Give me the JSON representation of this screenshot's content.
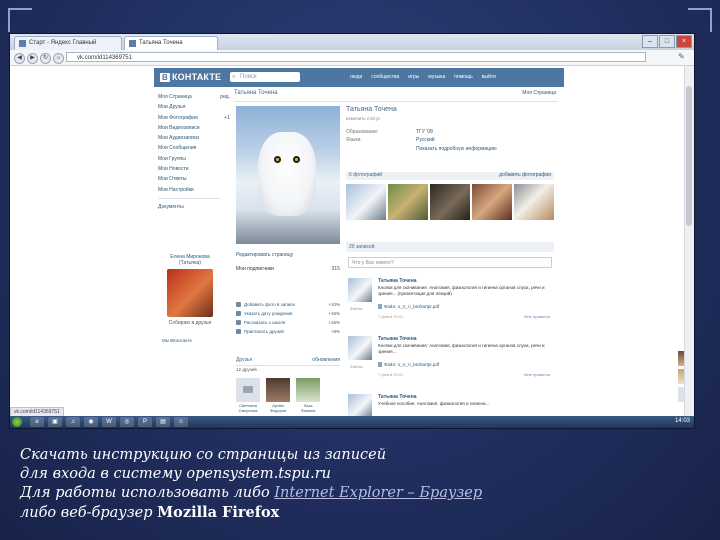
{
  "browser": {
    "tabs": [
      {
        "label": "Старт - Яндекс Главный"
      },
      {
        "label": "Татьяна Точена"
      }
    ],
    "url": "vk.com/id114369751",
    "window_buttons": [
      "–",
      "□",
      "×"
    ],
    "status_url": "vk.com/id114369751"
  },
  "vk": {
    "logo_mark": "B",
    "logo_text": "КОНТАКТЕ",
    "search_placeholder": "Поиск",
    "top_menu": [
      "люди",
      "сообщества",
      "игры",
      "музыка",
      "помощь",
      "выйти"
    ],
    "left_menu": [
      {
        "label": "Моя Страница",
        "count": "ред."
      },
      {
        "label": "Мои Друзья",
        "count": ""
      },
      {
        "label": "Мои Фотографии",
        "count": "+1"
      },
      {
        "label": "Мои Видеозаписи",
        "count": ""
      },
      {
        "label": "Мои Аудиозаписи",
        "count": ""
      },
      {
        "label": "Мои Сообщения",
        "count": ""
      },
      {
        "label": "Мои Группы",
        "count": ""
      },
      {
        "label": "Мои Новости",
        "count": ""
      },
      {
        "label": "Мои Ответы",
        "count": ""
      },
      {
        "label": "Мои Настройки",
        "count": ""
      }
    ],
    "left_extra": "Документы",
    "friend_card": {
      "name": "Елена Миронова (Татьяна)",
      "status": "Собираю в друзья"
    },
    "left_small": "Мы ВКонтакте"
  },
  "profile": {
    "header_name": "Татьяна Точена",
    "header_right": "Моя Страница",
    "name": "Татьяна Точена",
    "status": "изменить статус",
    "info": [
      {
        "key": "Образование:",
        "value": "ТГУ '08"
      },
      {
        "key": "Языки:",
        "value": "Русский"
      }
    ],
    "more_info": "Показать подробную информацию",
    "edit_link": "Редактировать страницу",
    "followers_label": "Мои подписчики",
    "followers_count": "315",
    "subscriptions": [
      {
        "label": "Добавить фото в записи",
        "pct": "+10%"
      },
      {
        "label": "Указать дату рождения",
        "pct": "+15%"
      },
      {
        "label": "Рассказать о школе",
        "pct": "+15%"
      },
      {
        "label": "Пригласить друзей",
        "pct": "+8%"
      }
    ],
    "friends_title": "Друзья",
    "friends_right": "обновления",
    "friends_sub": "12 друзей",
    "friends": [
      {
        "name": "Светлана Смирнова"
      },
      {
        "name": "Артём Федоров"
      },
      {
        "name": "Лиза Фомина"
      }
    ],
    "photos_title": "6 фотографий",
    "photos_right": "добавить фотографии",
    "wall_title": "20 записей",
    "wall_placeholder": "Что у Вас нового?",
    "posts": [
      {
        "author": "Татьяна Точена",
        "text": "Кнопки для скачивания: Анатомия, физиология и гигиена органов слуха, речи и зрения... (презентация для лекций)",
        "file": "Файл: о_п_тi_bezkartpr.pdf",
        "date": "7 фев в 20:01",
        "meta": "Файлы",
        "like": "Мне нравится"
      },
      {
        "author": "Татьяна Точена",
        "text": "Кнопки для скачивания: Анатомия, физиология и гигиена органов слуха, речи и зрения...",
        "file": "Файл: о_п_тi_bezkartpr.pdf",
        "date": "7 фев в 20:01",
        "meta": "Файлы",
        "like": "Мне нравится"
      },
      {
        "author": "Татьяна Точена",
        "text": "Учебное пособие: Анатомия, физиология и гигиена...",
        "file": "",
        "date": "",
        "meta": "",
        "like": ""
      }
    ]
  },
  "taskbar": {
    "clock": "14:03"
  },
  "caption": {
    "line1": "Скачать инструкцию со страницы из записей",
    "line2": "для входа в систему opensystem.tspu.ru",
    "line3_prefix": "Для работы использовать либо ",
    "line3_link": "Internet Explorer – Браузер",
    "line4_prefix": "либо веб-браузер ",
    "line4_bold": "Mozilla Firefox"
  },
  "colors": {
    "vk_blue": "#4d76a1",
    "vk_link": "#2b587a",
    "slide_bg": "#233265",
    "caption_link": "#b9bce0"
  }
}
